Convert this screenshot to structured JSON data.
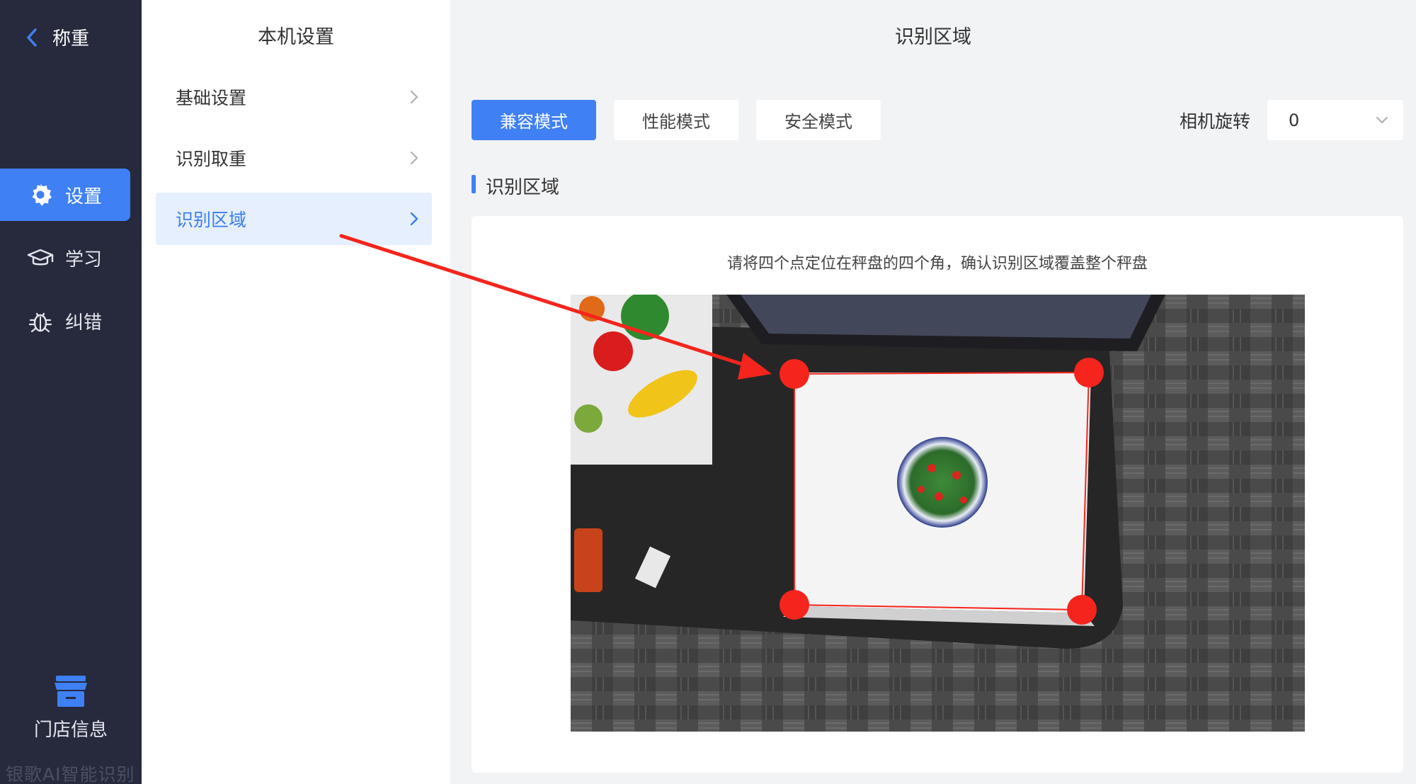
{
  "sidebar": {
    "back_label": "称重",
    "items": [
      {
        "label": "设置",
        "icon": "gear-icon",
        "active": true
      },
      {
        "label": "学习",
        "icon": "graduation-cap-icon",
        "active": false
      },
      {
        "label": "纠错",
        "icon": "bug-icon",
        "active": false
      }
    ],
    "store_label": "门店信息",
    "brand_text": "银歌AI智能识别"
  },
  "settings_panel": {
    "title": "本机设置",
    "items": [
      {
        "label": "基础设置",
        "active": false
      },
      {
        "label": "识别取重",
        "active": false
      },
      {
        "label": "识别区域",
        "active": true
      }
    ]
  },
  "main": {
    "title": "识别区域",
    "modes": [
      {
        "label": "兼容模式",
        "active": true
      },
      {
        "label": "性能模式",
        "active": false
      },
      {
        "label": "安全模式",
        "active": false
      }
    ],
    "rotation": {
      "label": "相机旋转",
      "value": "0"
    },
    "section_title": "识别区域",
    "instruction": "请将四个点定位在秤盘的四个角，确认识别区域覆盖整个秤盘"
  },
  "colors": {
    "sidebar_bg": "#262a3c",
    "accent": "#3f80f4",
    "marker_red": "#f5241c"
  }
}
